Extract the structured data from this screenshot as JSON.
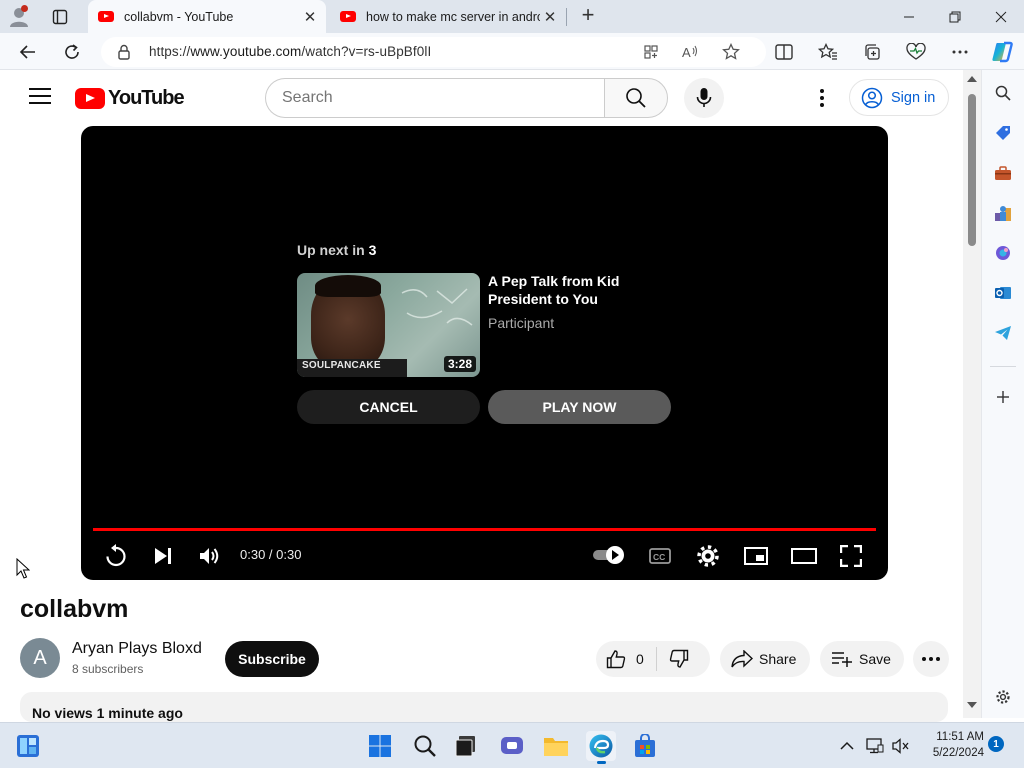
{
  "browser": {
    "tabs": [
      {
        "title": "collabvm - YouTube",
        "active": true
      },
      {
        "title": "how to make mc server in andro",
        "active": false
      }
    ],
    "address": {
      "url_prefix": "https://",
      "url_host": "www.youtube.com",
      "url_path": "/watch?v=rs-uBpBf0lI"
    }
  },
  "youtube": {
    "logo_text": "YouTube",
    "search_placeholder": "Search",
    "signin_label": "Sign in"
  },
  "player": {
    "up_next_prefix": "Up next in",
    "up_next_count": "3",
    "next_video": {
      "title": "A Pep Talk from Kid President to You",
      "channel": "Participant",
      "duration": "3:28",
      "thumbnail_brand": "SOULPANCAKE"
    },
    "cancel_label": "CANCEL",
    "play_now_label": "PLAY NOW",
    "time_display": "0:30 / 0:30",
    "progress_fraction": 1.0,
    "progress_color": "#ff0000"
  },
  "video": {
    "title": "collabvm",
    "channel_initial": "A",
    "channel_name": "Aryan Plays Bloxd",
    "subscribers": "8 subscribers",
    "subscribe_label": "Subscribe",
    "like_count": "0",
    "share_label": "Share",
    "save_label": "Save",
    "description_meta": "No views  1 minute ago"
  },
  "taskbar": {
    "time": "11:51 AM",
    "date": "5/22/2024",
    "notification_count": "1"
  }
}
